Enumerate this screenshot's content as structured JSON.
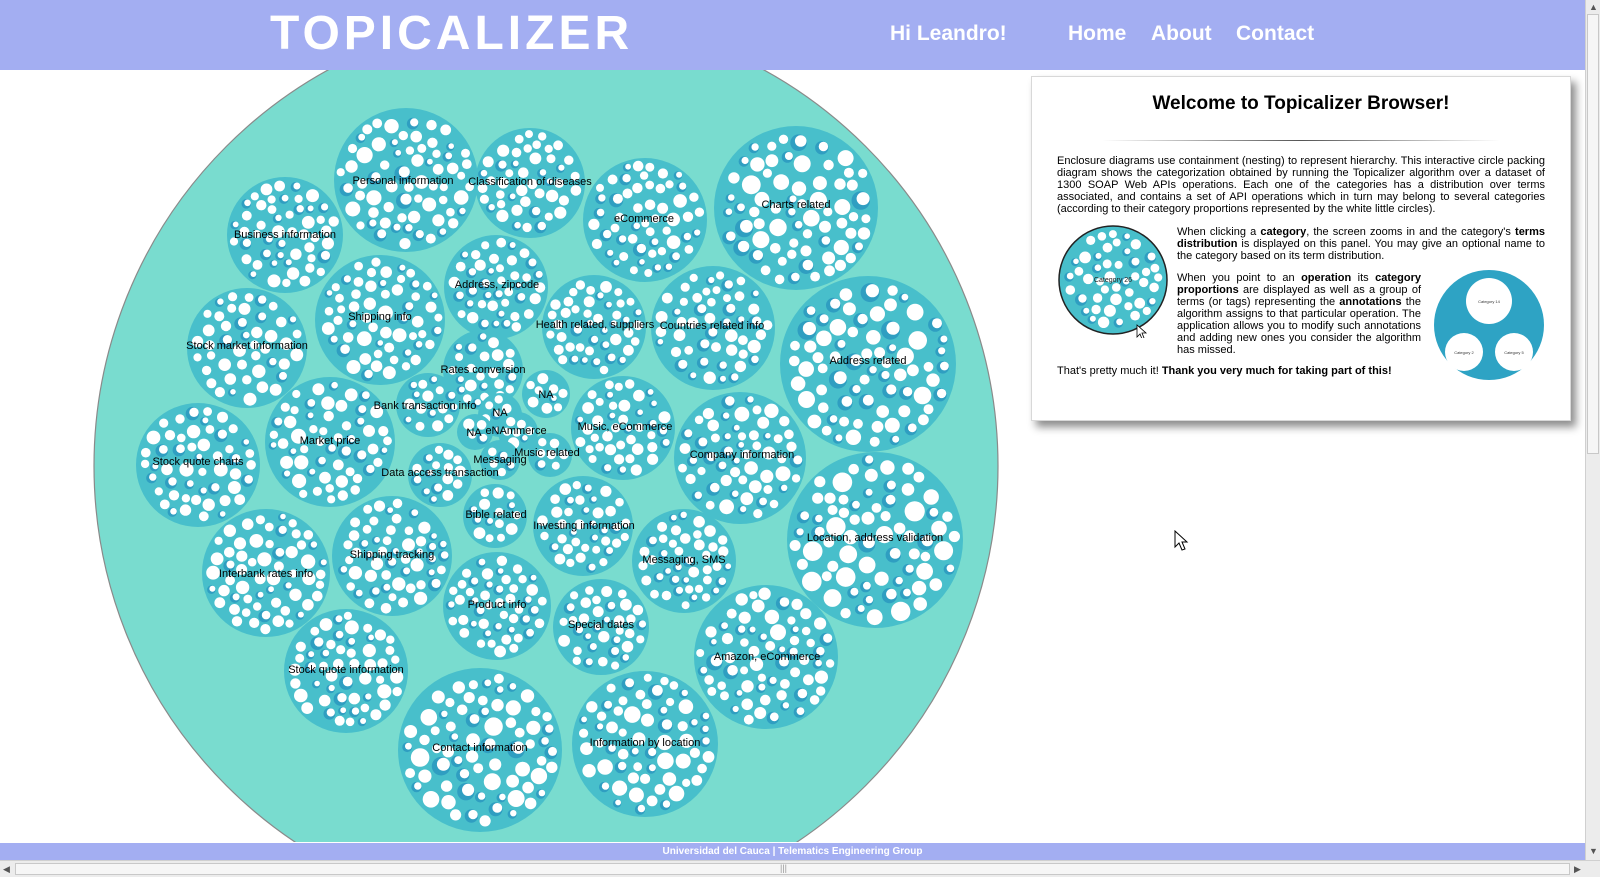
{
  "header": {
    "brand": "TOPICALIZER",
    "greeting": "Hi Leandro!",
    "nav": [
      "Home",
      "About",
      "Contact"
    ]
  },
  "colors": {
    "header_bg": "#a3aef2",
    "outer_circle": "#79dccf",
    "category_circle": "#48bfcb",
    "operation_dark": "#2f9ec1",
    "operation_light": "#ffffff"
  },
  "categories": [
    "Personal information",
    "Classification of diseases",
    "Business information",
    "eCommerce",
    "Charts related",
    "Address, zipcode",
    "Shipping info",
    "Stock market information",
    "Health related, suppliers",
    "Countries related info",
    "Rates conversion",
    "Address related",
    "NA",
    "Bank transaction info",
    "NA",
    "NA",
    "eNAmmerce",
    "Music, eCommerce",
    "Market price",
    "Messaging",
    "Music related",
    "Stock quote charts",
    "Data access transaction",
    "Company information",
    "Bible related",
    "Investing information",
    "Location, address validation",
    "Shipping tracking",
    "Messaging, SMS",
    "Interbank rates info",
    "Product info",
    "Special dates",
    "Amazon, eCommerce",
    "Stock quote information",
    "Contact information",
    "Information by location"
  ],
  "panel": {
    "title": "Welcome to Topicalizer Browser!",
    "intro": "Enclosure diagrams use containment (nesting) to represent hierarchy. This interactive circle packing diagram shows the categorization obtained by running the Topicalizer algorithm over a dataset of 1300 SOAP Web APIs operations. Each one of the categories has a distribution over terms associated, and contains a set of API operations which in turn may belong to several categories (according to their category proportions represented by the white little circles).",
    "p1": {
      "a": "When clicking a ",
      "b": "category",
      "c": ", the screen zooms in and the category's ",
      "d": "terms distribution",
      "e": " is displayed on this panel. You may give an optional name to the category based on its term distribution."
    },
    "p2": {
      "a": "When you point to an ",
      "b": "operation",
      "c": " its ",
      "d": "category proportions",
      "e": " are displayed as well as a group of terms (or tags) representing the ",
      "f": "annotations",
      "g": " the algorithm assigns to that particular operation. The application allows you to modify such annotations and adding new ones you consider the algorithm has missed."
    },
    "closing_a": "That's pretty much it! ",
    "closing_b": "Thank you very much for taking part of this!",
    "example_category_label": "Category 26",
    "example_operation_labels": [
      "Category 14",
      "Category 2",
      "Category 5"
    ]
  },
  "footer": "Universidad del Cauca | Telematics Engineering Group"
}
